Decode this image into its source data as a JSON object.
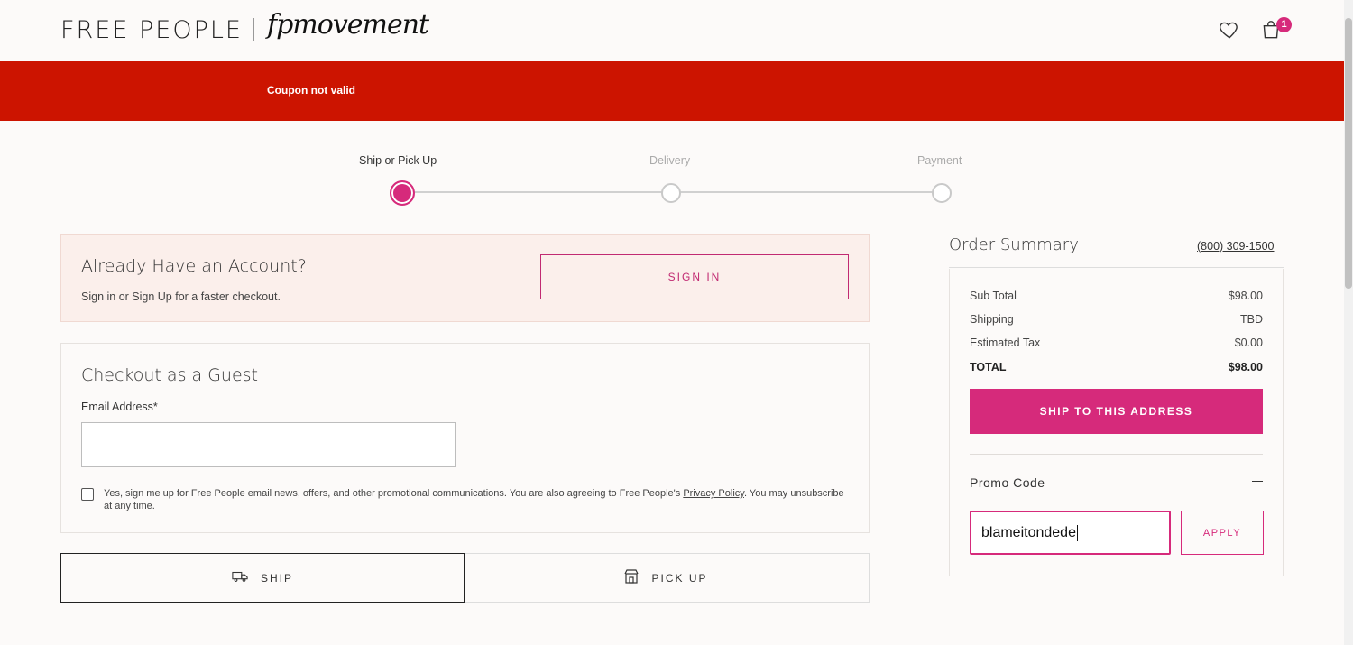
{
  "header": {
    "brand": "FREE PEOPLE",
    "sub_brand": "fpmovement",
    "bag_count": "1"
  },
  "banner": {
    "message": "Coupon not valid"
  },
  "steps": [
    {
      "label": "Ship or Pick Up",
      "active": true
    },
    {
      "label": "Delivery",
      "active": false
    },
    {
      "label": "Payment",
      "active": false
    }
  ],
  "account": {
    "title": "Already Have an Account?",
    "subtitle": "Sign in or Sign Up for a faster checkout.",
    "signin_label": "SIGN IN"
  },
  "guest": {
    "title": "Checkout as a Guest",
    "email_label": "Email Address*",
    "email_value": "",
    "consent_text": "Yes, sign me up for Free People email news, offers, and other promotional communications. You are also agreeing to Free People's ",
    "privacy_link": "Privacy Policy",
    "consent_tail": ". You may unsubscribe at any time."
  },
  "fulfillment": {
    "ship_label": "SHIP",
    "pickup_label": "PICK UP"
  },
  "order_summary": {
    "title": "Order Summary",
    "phone": "(800) 309-1500",
    "rows": [
      {
        "label": "Sub Total",
        "value": "$98.00"
      },
      {
        "label": "Shipping",
        "value": "TBD"
      },
      {
        "label": "Estimated Tax",
        "value": "$0.00"
      },
      {
        "label": "TOTAL",
        "value": "$98.00"
      }
    ],
    "ship_button": "SHIP TO THIS ADDRESS",
    "promo_label": "Promo Code",
    "promo_value": "blameitondede",
    "apply_label": "APPLY"
  },
  "colors": {
    "accent": "#d62a7b",
    "banner": "#cc1400",
    "panel_bg": "#fbefeb"
  }
}
